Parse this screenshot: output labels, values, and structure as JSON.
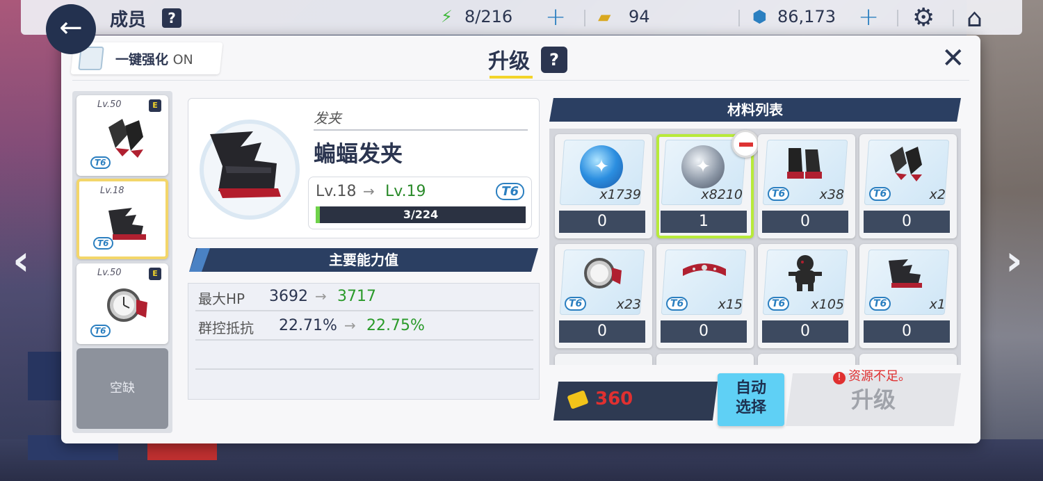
{
  "topbar": {
    "title": "成员",
    "help": "?",
    "stamina": "8/216",
    "tickets": "94",
    "gems": "86,173"
  },
  "modal": {
    "onekey_label": "一键强化",
    "onekey_state": "ON",
    "title": "升级",
    "help": "?",
    "close": "✕"
  },
  "equip_slots": [
    {
      "lv": "Lv.50",
      "rank": "E",
      "tier": "T6"
    },
    {
      "lv": "Lv.18",
      "rank": "",
      "tier": "T6"
    },
    {
      "lv": "Lv.50",
      "rank": "E",
      "tier": "T6"
    }
  ],
  "empty_slot": "空缺",
  "item": {
    "category": "发夹",
    "name": "蝙蝠发夹",
    "lv_from": "Lv.18",
    "lv_to": "Lv.19",
    "tier": "T6",
    "exp_text": "3/224",
    "exp_progress": 0.0134
  },
  "stats": {
    "header": "主要能力值",
    "rows": [
      {
        "name": "最大HP",
        "from": "3692",
        "to": "3717"
      },
      {
        "name": "群控抵抗",
        "from": "22.71%",
        "to": "22.75%"
      }
    ]
  },
  "materials": {
    "header": "材料列表",
    "items": [
      {
        "type": "blue-orb",
        "tier": "",
        "count": "x1739",
        "qty": "0"
      },
      {
        "type": "silver-orb",
        "tier": "",
        "count": "x8210",
        "qty": "1",
        "selected": true
      },
      {
        "type": "boots",
        "tier": "T6",
        "count": "x38",
        "qty": "0"
      },
      {
        "type": "gloves",
        "tier": "T6",
        "count": "x2",
        "qty": "0"
      },
      {
        "type": "watch",
        "tier": "T6",
        "count": "x23",
        "qty": "0"
      },
      {
        "type": "collar",
        "tier": "T6",
        "count": "x15",
        "qty": "0"
      },
      {
        "type": "doll",
        "tier": "T6",
        "count": "x105",
        "qty": "0"
      },
      {
        "type": "hairclip",
        "tier": "T6",
        "count": "x1",
        "qty": "0"
      }
    ]
  },
  "actions": {
    "cost": "360",
    "auto_select": "自动选择",
    "upgrade": "升级",
    "warning": "资源不足。"
  },
  "colors": {
    "navy": "#2b3550",
    "green": "#2a8a2a",
    "red": "#e03030",
    "cyan": "#5fd0f5",
    "accent_yellow": "#f2d42a"
  }
}
